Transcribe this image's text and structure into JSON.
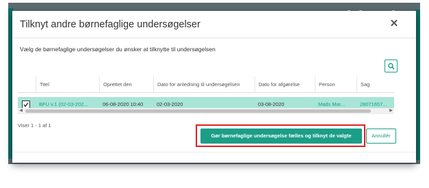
{
  "dialog": {
    "title": "Tilknyt andre børnefaglige undersøgelser",
    "close_symbol": "✕",
    "instruction": "Vælg de børnefaglige undersøgelser du ønsker at tilknytte til undersøgelsen"
  },
  "table": {
    "columns": [
      "Titel",
      "Oprettet den",
      "Dato for anledning til undersøgelsen",
      "Dato for afgørelse",
      "Person",
      "Sag"
    ],
    "rows": [
      {
        "selected": true,
        "titel": "BFU v.1 (02-03-202...",
        "oprettet": "06-08-2020 10:40",
        "anledning": "02-03-2020",
        "afgoerelse": "03-08-2020",
        "person": "Mads Mar...",
        "sag": "28071657..."
      }
    ]
  },
  "pager": {
    "info": "Viser 1 - 1 af 1"
  },
  "actions": {
    "primary_label": "Gør børnefaglige undersøgelse fælles og tilknyt de valgte",
    "cancel_label": "Annullér"
  },
  "icons": {
    "search": "search-icon",
    "close": "close-icon",
    "checkmark": "checkmark-icon"
  },
  "colors": {
    "accent": "#1b9e88",
    "selected_row": "#a8e5d7",
    "highlight": "#e0201c"
  }
}
